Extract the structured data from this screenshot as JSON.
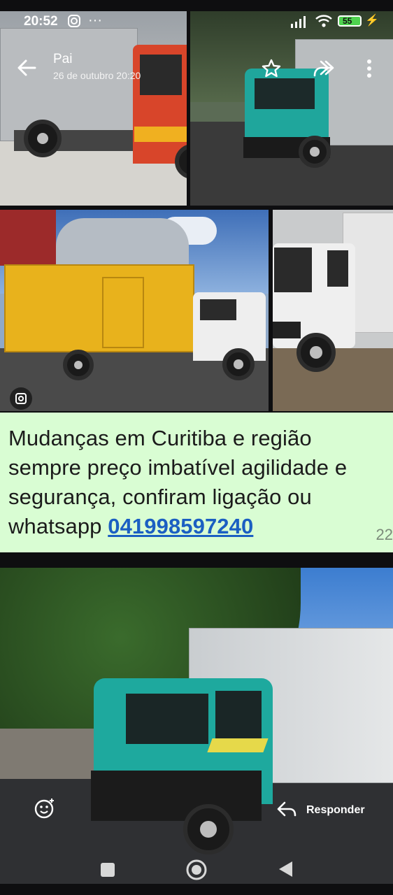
{
  "status_bar": {
    "time": "20:52",
    "battery": "55"
  },
  "header": {
    "contact_name": "Pai",
    "date": "26 de outubro 20:20"
  },
  "message": {
    "caption": "Mudanças em Curitiba e região sempre preço imbatível agilidade e segurança, confiram ligação ou whatsapp",
    "phone_link": "041998597240",
    "time_partial": "22"
  },
  "footer": {
    "reply_label": "Responder"
  },
  "icons": {
    "back": "arrow-left-icon",
    "star": "star-icon",
    "forward": "forward-icon",
    "menu": "more-vertical-icon",
    "react": "emoji-add-icon",
    "reply": "reply-icon"
  },
  "colors": {
    "caption_bg": "#d9fdd3",
    "link": "#1b5fc2",
    "truck_teal": "#1aa39a",
    "truck_yellow": "#e8b21c"
  }
}
